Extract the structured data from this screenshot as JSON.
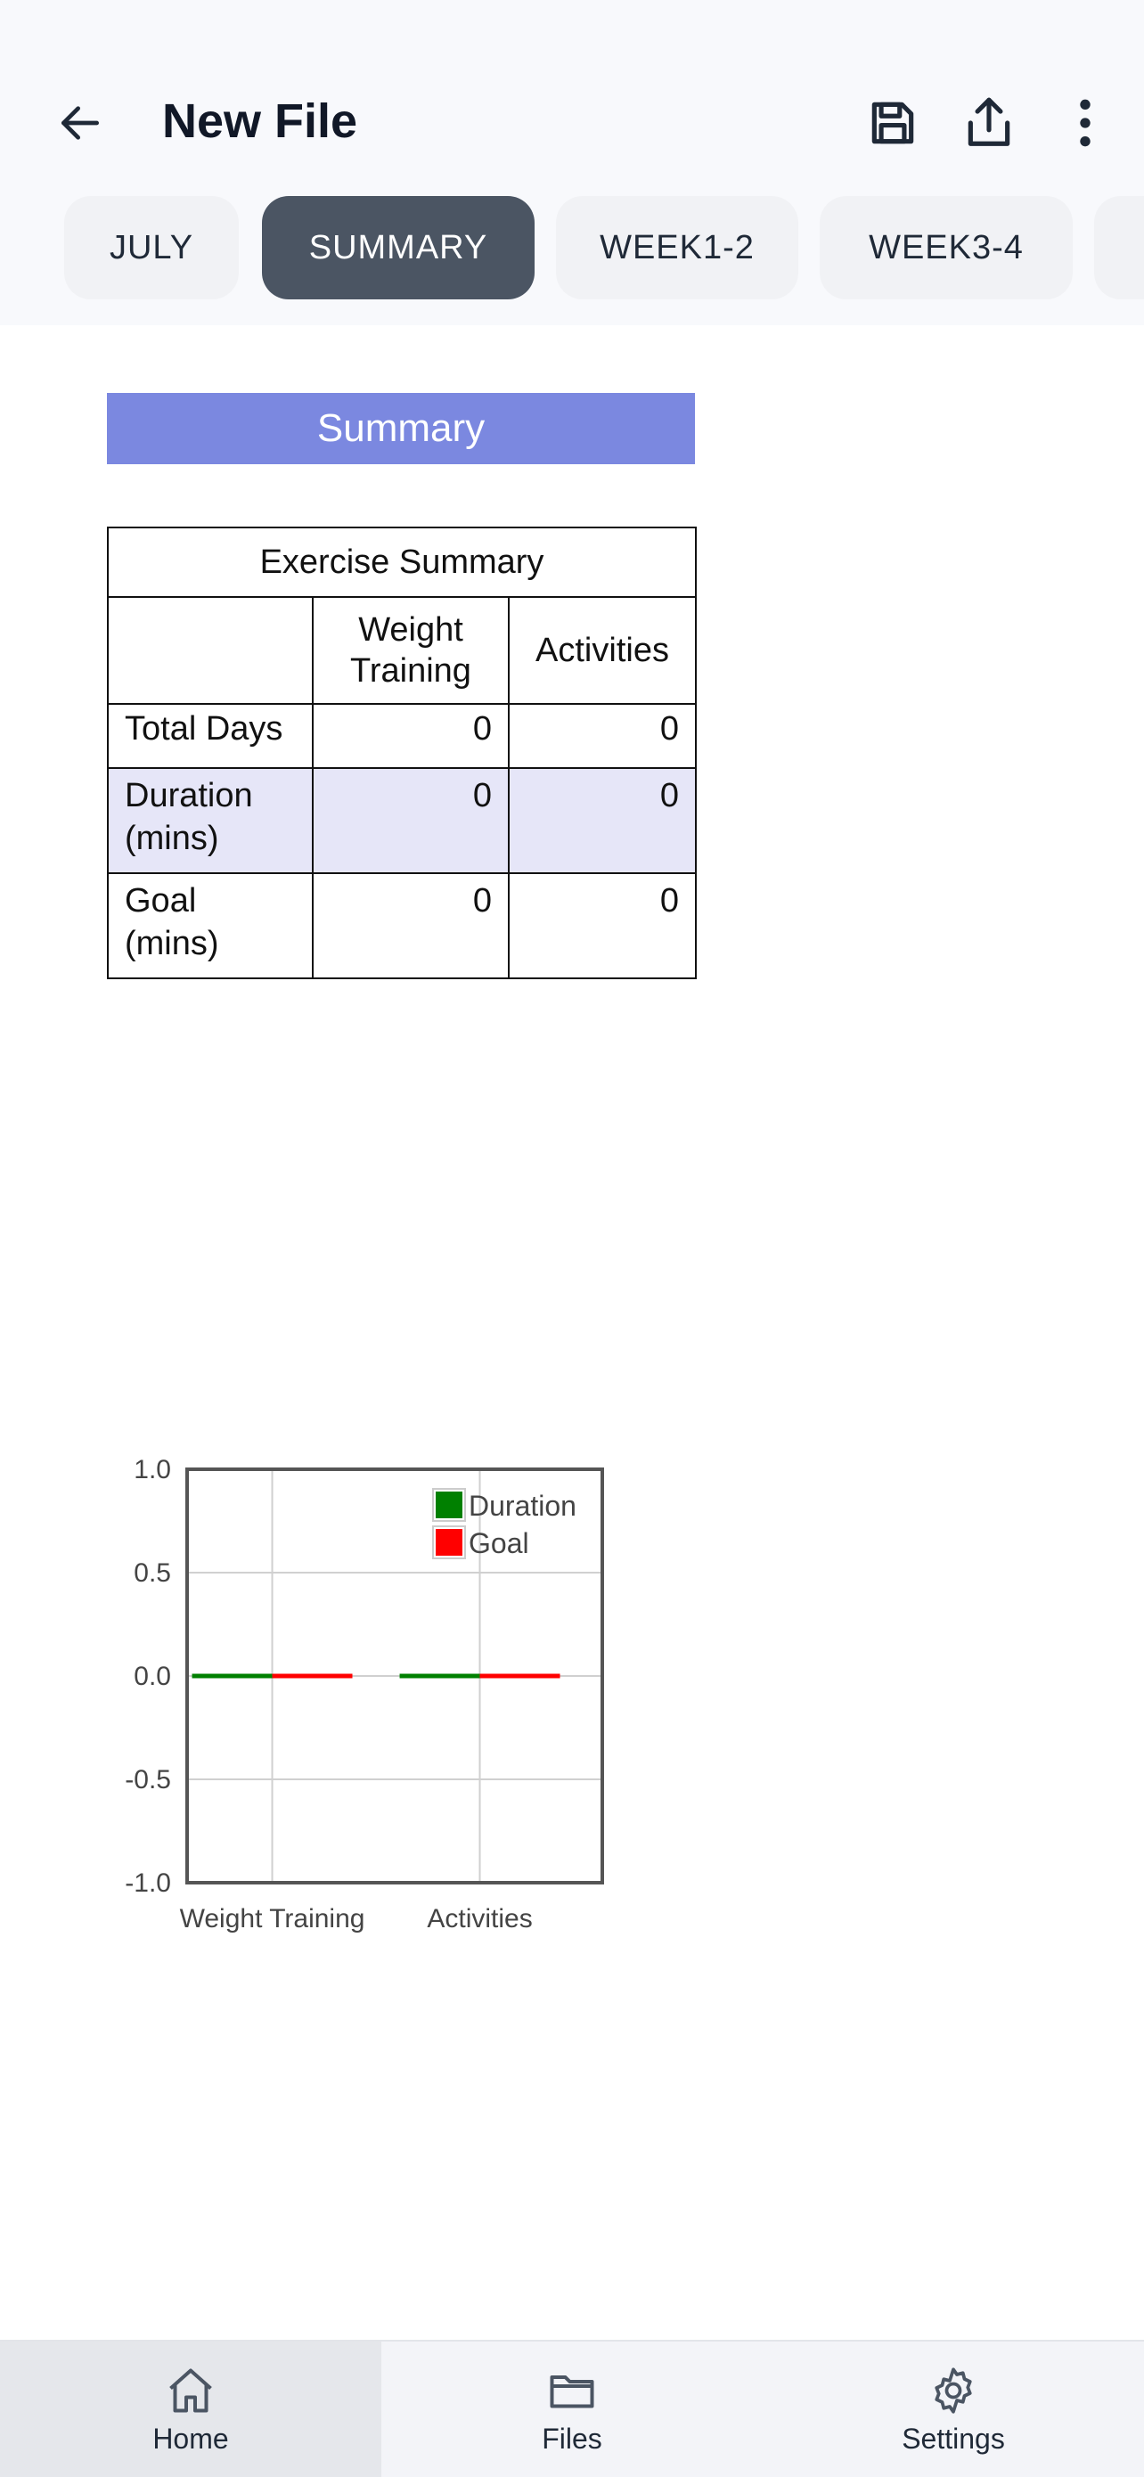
{
  "header": {
    "title": "New File",
    "back_icon": "arrow-left-icon",
    "actions": [
      "save-icon",
      "share-icon",
      "more-vertical-icon"
    ]
  },
  "tabs": [
    {
      "label": "JULY",
      "active": false
    },
    {
      "label": "SUMMARY",
      "active": true
    },
    {
      "label": "WEEK1-2",
      "active": false
    },
    {
      "label": "WEEK3-4",
      "active": false
    }
  ],
  "sheet": {
    "banner": "Summary",
    "table": {
      "title": "Exercise Summary",
      "columns": [
        "",
        "Weight Training",
        "Activities"
      ],
      "rows": [
        {
          "label": "Total Days",
          "weight_training": "0",
          "activities": "0"
        },
        {
          "label": "Duration (mins)",
          "weight_training": "0",
          "activities": "0"
        },
        {
          "label": "Goal (mins)",
          "weight_training": "0",
          "activities": "0"
        }
      ]
    }
  },
  "chart_data": {
    "type": "bar",
    "categories": [
      "Weight Training",
      "Activities"
    ],
    "series": [
      {
        "name": "Duration",
        "values": [
          0,
          0
        ],
        "color": "#008000"
      },
      {
        "name": "Goal",
        "values": [
          0,
          0
        ],
        "color": "#ff0000"
      }
    ],
    "yticks": [
      "1.0",
      "0.5",
      "0.0",
      "-0.5",
      "-1.0"
    ],
    "ylim": [
      -1.0,
      1.0
    ],
    "grid": true,
    "legend": "top-right"
  },
  "bottom_nav": [
    {
      "label": "Home",
      "icon": "home-icon",
      "active": true
    },
    {
      "label": "Files",
      "icon": "folder-icon",
      "active": false
    },
    {
      "label": "Settings",
      "icon": "gear-icon",
      "active": false
    }
  ]
}
